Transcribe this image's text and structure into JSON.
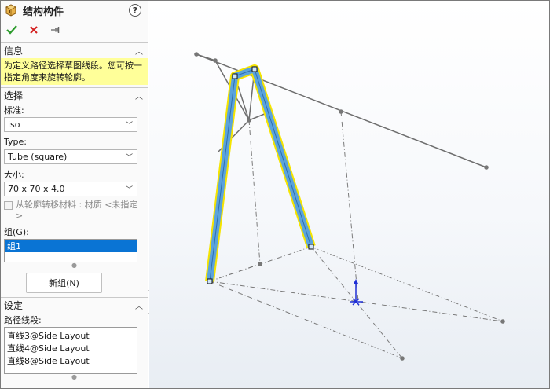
{
  "panel": {
    "title": "结构构件",
    "icons": {
      "title": "structural-member-icon",
      "help": "help-icon",
      "ok": "checkmark-icon",
      "cancel": "close-icon",
      "pin": "pushpin-icon"
    },
    "help_label": "?"
  },
  "info": {
    "header": "信息",
    "message": "为定义路径选择草图线段。您可按一指定角度来旋转轮廓。"
  },
  "selection": {
    "header": "选择",
    "standard_label": "标准:",
    "standard_value": "iso",
    "type_label": "Type:",
    "type_value": "Tube (square)",
    "size_label": "大小:",
    "size_value": "70 x 70 x 4.0",
    "transfer_material_label": "从轮廓转移材料 : 材质 <未指定>",
    "transfer_material_checked": false,
    "group_label": "组(G):",
    "groups": [
      "组1"
    ],
    "new_group_button": "新组(N)"
  },
  "settings": {
    "header": "设定",
    "path_segments_label": "路径线段:",
    "path_segments": [
      "直线3@Side Layout",
      "直线4@Side Layout",
      "直线8@Side Layout"
    ]
  },
  "colors": {
    "accent": "#0a74d4",
    "info_bg": "#ffff99",
    "member_blue": "#5ba3dc",
    "member_highlight": "#f5e400",
    "sketch_line": "#6e6e6e",
    "triad_blue": "#1f2fd6"
  }
}
